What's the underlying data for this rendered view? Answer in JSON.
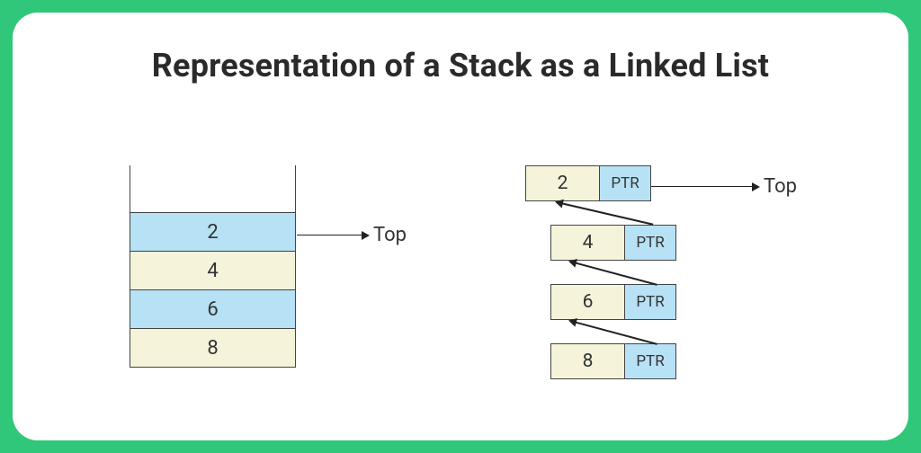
{
  "title": "Representation of a Stack as a Linked List",
  "labels": {
    "top": "Top",
    "ptr": "PTR"
  },
  "stack": {
    "cells": [
      {
        "value": "2",
        "color": "sky"
      },
      {
        "value": "4",
        "color": "cream"
      },
      {
        "value": "6",
        "color": "sky"
      },
      {
        "value": "8",
        "color": "cream"
      }
    ]
  },
  "linked_list": {
    "nodes": [
      {
        "value": "2"
      },
      {
        "value": "4"
      },
      {
        "value": "6"
      },
      {
        "value": "8"
      }
    ]
  }
}
